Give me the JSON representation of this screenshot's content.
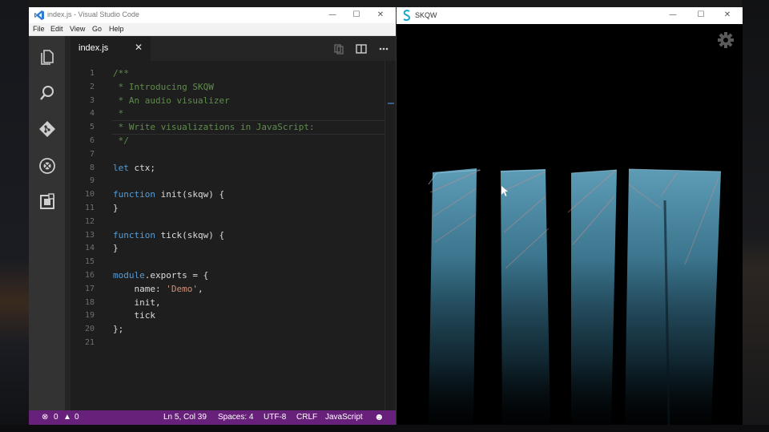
{
  "vscode": {
    "window_title": "index.js - Visual Studio Code",
    "window_controls": {
      "minimize": "—",
      "maximize": "☐",
      "close": "✕"
    },
    "menu": [
      "File",
      "Edit",
      "View",
      "Go",
      "Help"
    ],
    "activity_bar": [
      "explorer-icon",
      "search-icon",
      "git-icon",
      "debug-icon",
      "extensions-icon"
    ],
    "tab": {
      "label": "index.js",
      "close": "✕"
    },
    "code": [
      {
        "n": "1",
        "parts": [
          [
            "com",
            "/**"
          ]
        ]
      },
      {
        "n": "2",
        "parts": [
          [
            "com",
            " * Introducing SKQW"
          ]
        ]
      },
      {
        "n": "3",
        "parts": [
          [
            "com",
            " * An audio visualizer"
          ]
        ]
      },
      {
        "n": "4",
        "parts": [
          [
            "com",
            " *"
          ]
        ]
      },
      {
        "n": "5",
        "parts": [
          [
            "com",
            " * Write visualizations in JavaScript:"
          ]
        ]
      },
      {
        "n": "6",
        "parts": [
          [
            "com",
            " */"
          ]
        ]
      },
      {
        "n": "7",
        "parts": []
      },
      {
        "n": "8",
        "parts": [
          [
            "kw",
            "let"
          ],
          [
            "id",
            " ctx;"
          ]
        ]
      },
      {
        "n": "9",
        "parts": []
      },
      {
        "n": "10",
        "parts": [
          [
            "kw",
            "function"
          ],
          [
            "id",
            " init(skqw) {"
          ]
        ]
      },
      {
        "n": "11",
        "parts": [
          [
            "id",
            "}"
          ]
        ]
      },
      {
        "n": "12",
        "parts": []
      },
      {
        "n": "13",
        "parts": [
          [
            "kw",
            "function"
          ],
          [
            "id",
            " tick(skqw) {"
          ]
        ]
      },
      {
        "n": "14",
        "parts": [
          [
            "id",
            "}"
          ]
        ]
      },
      {
        "n": "15",
        "parts": []
      },
      {
        "n": "16",
        "parts": [
          [
            "kw",
            "module"
          ],
          [
            "id",
            ".exports = {"
          ]
        ]
      },
      {
        "n": "17",
        "parts": [
          [
            "id",
            "    name: "
          ],
          [
            "str",
            "'Demo'"
          ],
          [
            "id",
            ","
          ]
        ]
      },
      {
        "n": "18",
        "parts": [
          [
            "id",
            "    init,"
          ]
        ]
      },
      {
        "n": "19",
        "parts": [
          [
            "id",
            "    tick"
          ]
        ]
      },
      {
        "n": "20",
        "parts": [
          [
            "id",
            "};"
          ]
        ]
      },
      {
        "n": "21",
        "parts": []
      }
    ],
    "status": {
      "errors": "0",
      "warnings": "0",
      "position": "Ln 5, Col 39",
      "spaces": "Spaces: 4",
      "encoding": "UTF-8",
      "eol": "CRLF",
      "language": "JavaScript",
      "feedback": "☻"
    },
    "colors": {
      "status_bar": "#68217a",
      "comment": "#608b4e",
      "keyword": "#569cd6",
      "string": "#ce9178"
    }
  },
  "skqw": {
    "window_title": "SKQW",
    "window_controls": {
      "minimize": "—",
      "maximize": "☐",
      "close": "✕"
    },
    "settings_icon": "gear-icon",
    "visual_colors": {
      "body": "#5aa7c4",
      "edge": "#d88b8b"
    }
  }
}
